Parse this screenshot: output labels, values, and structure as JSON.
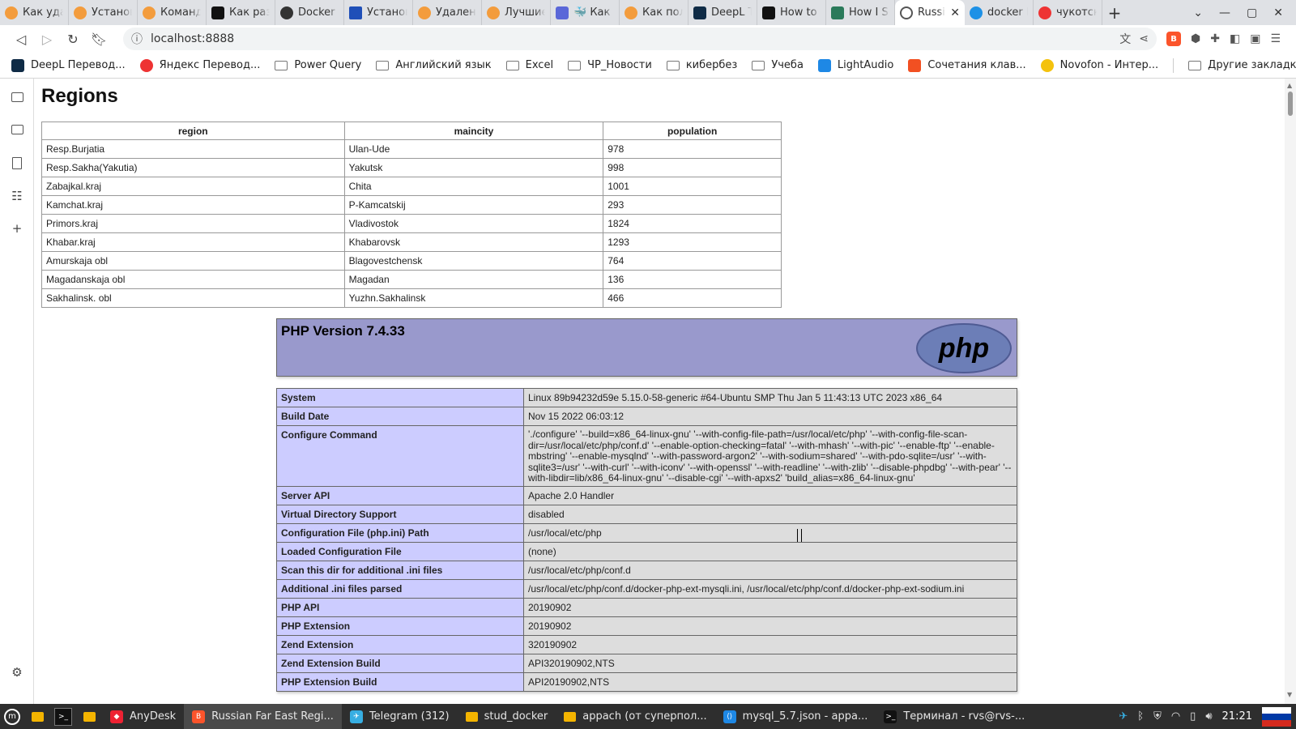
{
  "browser": {
    "tabs": [
      {
        "label": "Как удал",
        "icon": "it"
      },
      {
        "label": "Установ",
        "icon": "it"
      },
      {
        "label": "Команд",
        "icon": "it"
      },
      {
        "label": "Как разв",
        "icon": "med"
      },
      {
        "label": "Docker",
        "icon": "gh"
      },
      {
        "label": "Установ",
        "icon": "net"
      },
      {
        "label": "Удален",
        "icon": "it"
      },
      {
        "label": "Лучшие",
        "icon": "it"
      },
      {
        "label": "🐳 Как у",
        "icon": "pen"
      },
      {
        "label": "Как пол",
        "icon": "it"
      },
      {
        "label": "DeepL Tr",
        "icon": "deepl"
      },
      {
        "label": "How to c",
        "icon": "med"
      },
      {
        "label": "How I Se",
        "icon": "chat"
      },
      {
        "label": "Russi",
        "icon": "globe",
        "active": true
      },
      {
        "label": "docker b",
        "icon": "docker"
      },
      {
        "label": "чукотск",
        "icon": "ya"
      }
    ],
    "new_tab": "+",
    "url": "localhost:8888"
  },
  "bookmarks": {
    "items": [
      {
        "label": "DeepL Перевод...",
        "icon": "deepl"
      },
      {
        "label": "Яндекс Перевод...",
        "icon": "yandex"
      },
      {
        "label": "Power Query",
        "icon": "folder"
      },
      {
        "label": "Английский язык",
        "icon": "folder"
      },
      {
        "label": "Excel",
        "icon": "folder"
      },
      {
        "label": "ЧР_Новости",
        "icon": "folder"
      },
      {
        "label": "кибербез",
        "icon": "folder"
      },
      {
        "label": "Учеба",
        "icon": "folder"
      },
      {
        "label": "LightAudio",
        "icon": "audio"
      },
      {
        "label": "Сочетания клав...",
        "icon": "ms"
      },
      {
        "label": "Novofon - Интер...",
        "icon": "novofon"
      }
    ],
    "other": "Другие закладки"
  },
  "page": {
    "title": "Regions",
    "regions": {
      "headers": [
        "region",
        "maincity",
        "population"
      ],
      "rows": [
        [
          "Resp.Burjatia",
          "Ulan-Ude",
          "978"
        ],
        [
          "Resp.Sakha(Yakutia)",
          "Yakutsk",
          "998"
        ],
        [
          "Zabajkal.kraj",
          "Chita",
          "1001"
        ],
        [
          "Kamchat.kraj",
          "P-Kamcatskij",
          "293"
        ],
        [
          "Primors.kraj",
          "Vladivostok",
          "1824"
        ],
        [
          "Khabar.kraj",
          "Khabarovsk",
          "1293"
        ],
        [
          "Amurskaja obl",
          "Blagovestchensk",
          "764"
        ],
        [
          "Magadanskaja obl",
          "Magadan",
          "136"
        ],
        [
          "Sakhalinsk. obl",
          "Yuzhn.Sakhalinsk",
          "466"
        ]
      ]
    },
    "php": {
      "version": "PHP Version 7.4.33",
      "logo_text": "php",
      "info": [
        {
          "key": "System",
          "value": "Linux 89b94232d59e 5.15.0-58-generic #64-Ubuntu SMP Thu Jan 5 11:43:13 UTC 2023 x86_64"
        },
        {
          "key": "Build Date",
          "value": "Nov 15 2022 06:03:12"
        },
        {
          "key": "Configure Command",
          "value": "'./configure' '--build=x86_64-linux-gnu' '--with-config-file-path=/usr/local/etc/php' '--with-config-file-scan-\ndir=/usr/local/etc/php/conf.d' '--enable-option-checking=fatal' '--with-mhash' '--with-pic' '--enable-ftp' '--enable-\nmbstring' '--enable-mysqlnd' '--with-password-argon2' '--with-sodium=shared' '--with-pdo-sqlite=/usr' '--with-\nsqlite3=/usr' '--with-curl' '--with-iconv' '--with-openssl' '--with-readline' '--with-zlib' '--disable-phpdbg' '--with-pear' '--\nwith-libdir=lib/x86_64-linux-gnu' '--disable-cgi' '--with-apxs2' 'build_alias=x86_64-linux-gnu'"
        },
        {
          "key": "Server API",
          "value": "Apache 2.0 Handler"
        },
        {
          "key": "Virtual Directory Support",
          "value": "disabled"
        },
        {
          "key": "Configuration File (php.ini) Path",
          "value": "/usr/local/etc/php"
        },
        {
          "key": "Loaded Configuration File",
          "value": "(none)"
        },
        {
          "key": "Scan this dir for additional .ini files",
          "value": "/usr/local/etc/php/conf.d"
        },
        {
          "key": "Additional .ini files parsed",
          "value": "/usr/local/etc/php/conf.d/docker-php-ext-mysqli.ini, /usr/local/etc/php/conf.d/docker-php-ext-sodium.ini"
        },
        {
          "key": "PHP API",
          "value": "20190902"
        },
        {
          "key": "PHP Extension",
          "value": "20190902"
        },
        {
          "key": "Zend Extension",
          "value": "320190902"
        },
        {
          "key": "Zend Extension Build",
          "value": "API320190902,NTS"
        },
        {
          "key": "PHP Extension Build",
          "value": "API20190902,NTS"
        }
      ]
    }
  },
  "taskbar": {
    "items": [
      {
        "label": "AnyDesk",
        "icon": "anydesk"
      },
      {
        "label": "Russian Far East Regi...",
        "icon": "brave",
        "active": true
      },
      {
        "label": "Telegram (312)",
        "icon": "telegram"
      },
      {
        "label": "stud_docker",
        "icon": "folder"
      },
      {
        "label": "appach (от суперпол...",
        "icon": "folder"
      },
      {
        "label": "mysql_5.7.json - appa...",
        "icon": "vscode"
      },
      {
        "label": "Терминал - rvs@rvs-...",
        "icon": "terminal"
      }
    ],
    "clock": "21:21"
  },
  "colors": {
    "php_header": "#9999cc",
    "php_key_bg": "#ccccff",
    "php_value_bg": "#dddddd",
    "taskbar_bg": "#2e2e2e"
  }
}
